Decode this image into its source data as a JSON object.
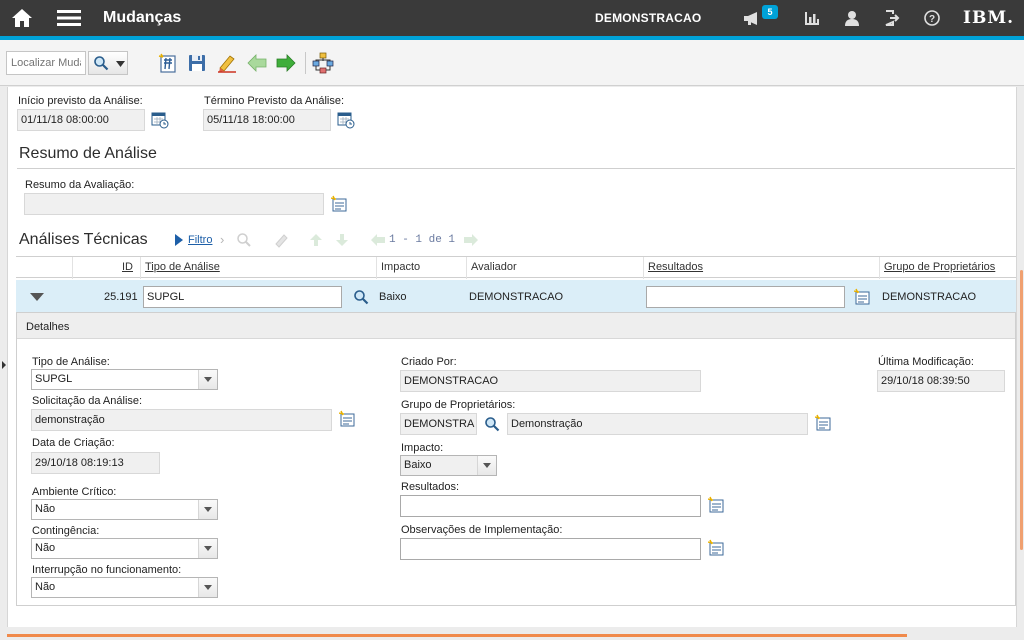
{
  "header": {
    "home_icon": "home-icon",
    "menu_icon": "hamburger-menu-icon",
    "title": "Mudanças",
    "user": "DEMONSTRACAO",
    "notification_count": "5",
    "logo": "IBM.",
    "accent_color": "#00a2d8"
  },
  "toolbar": {
    "search_placeholder": "Localizar Muda"
  },
  "analysis": {
    "start_label": "Início previsto da Análise:",
    "start_value": "01/11/18 08:00:00",
    "end_label": "Término Previsto da Análise:",
    "end_value": "05/11/18 18:00:00"
  },
  "summary": {
    "heading": "Resumo de Análise",
    "label": "Resumo da Avaliação:",
    "value": ""
  },
  "tech": {
    "heading": "Análises Técnicas",
    "filter_label": "Filtro",
    "pager": "1 - 1 de 1",
    "columns": {
      "id": "ID",
      "type": "Tipo de Análise",
      "impact": "Impacto",
      "evaluator": "Avaliador",
      "results": "Resultados",
      "owner_group": "Grupo de Proprietários"
    },
    "row": {
      "id": "25.191",
      "type": "SUPGL",
      "impact": "Baixo",
      "evaluator": "DEMONSTRACAO",
      "results": "",
      "owner_group": "DEMONSTRACAO"
    }
  },
  "details": {
    "title": "Detalhes",
    "type_label": "Tipo de Análise:",
    "type_value": "SUPGL",
    "request_label": "Solicitação da Análise:",
    "request_value": "demonstração",
    "created_label": "Data de Criação:",
    "created_value": "29/10/18 08:19:13",
    "critical_label": "Ambiente Crítico:",
    "critical_value": "Não",
    "contingency_label": "Contingência:",
    "contingency_value": "Não",
    "interruption_label": "Interrupção no funcionamento:",
    "interruption_value": "Não",
    "created_by_label": "Criado Por:",
    "created_by_value": "DEMONSTRACAO",
    "owner_group_label": "Grupo de Proprietários:",
    "owner_group_code": "DEMONSTRA",
    "owner_group_desc": "Demonstração",
    "impact_label": "Impacto:",
    "impact_value": "Baixo",
    "results_label": "Resultados:",
    "results_value": "",
    "notes_label": "Observações de Implementação:",
    "notes_value": "",
    "modified_label": "Última Modificação:",
    "modified_value": "29/10/18 08:39:50"
  }
}
